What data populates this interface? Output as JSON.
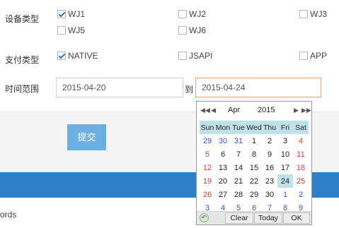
{
  "device_type": {
    "label": "设备类型",
    "options": [
      {
        "label": "WJ1",
        "checked": true
      },
      {
        "label": "WJ2",
        "checked": false
      },
      {
        "label": "WJ3",
        "checked": false
      },
      {
        "label": "WJ5",
        "checked": false
      },
      {
        "label": "WJ6",
        "checked": false
      }
    ]
  },
  "payment_type": {
    "label": "支付类型",
    "options": [
      {
        "label": "NATIVE",
        "checked": true
      },
      {
        "label": "JSAPI",
        "checked": false
      },
      {
        "label": "APP",
        "checked": false
      }
    ]
  },
  "time_range": {
    "label": "时间范围",
    "start": "2015-04-20",
    "separator": "到",
    "end": "2015-04-24"
  },
  "submit_label": "提交",
  "footer_partial": "ords",
  "calendar": {
    "month": "Apr",
    "year": "2015",
    "prev_year_icon": "double-chevron-left-icon",
    "prev_month_icon": "chevron-left-icon",
    "next_month_icon": "chevron-right-icon",
    "next_year_icon": "double-chevron-right-icon",
    "weekdays": [
      "Sun",
      "Mon",
      "Tue",
      "Wed",
      "Thu",
      "Fri",
      "Sat"
    ],
    "weeks": [
      [
        "29",
        "30",
        "31",
        "1",
        "2",
        "3",
        "4"
      ],
      [
        "5",
        "6",
        "7",
        "8",
        "9",
        "10",
        "11"
      ],
      [
        "12",
        "13",
        "14",
        "15",
        "16",
        "17",
        "18"
      ],
      [
        "19",
        "20",
        "21",
        "22",
        "23",
        "24",
        "25"
      ],
      [
        "26",
        "27",
        "28",
        "29",
        "30",
        "1",
        "2"
      ],
      [
        "3",
        "4",
        "5",
        "6",
        "7",
        "8",
        "9"
      ]
    ],
    "selected_day": "24",
    "clear_label": "Clear",
    "today_label": "Today",
    "ok_label": "OK",
    "colors": {
      "header_bg": "#bfe2ea",
      "weekend": "#d63a3a",
      "other_month": "#3b52c8"
    }
  },
  "colors": {
    "accent": "#2e7fc9",
    "submit": "#6cb0e2",
    "focus_border": "#e8a468"
  }
}
